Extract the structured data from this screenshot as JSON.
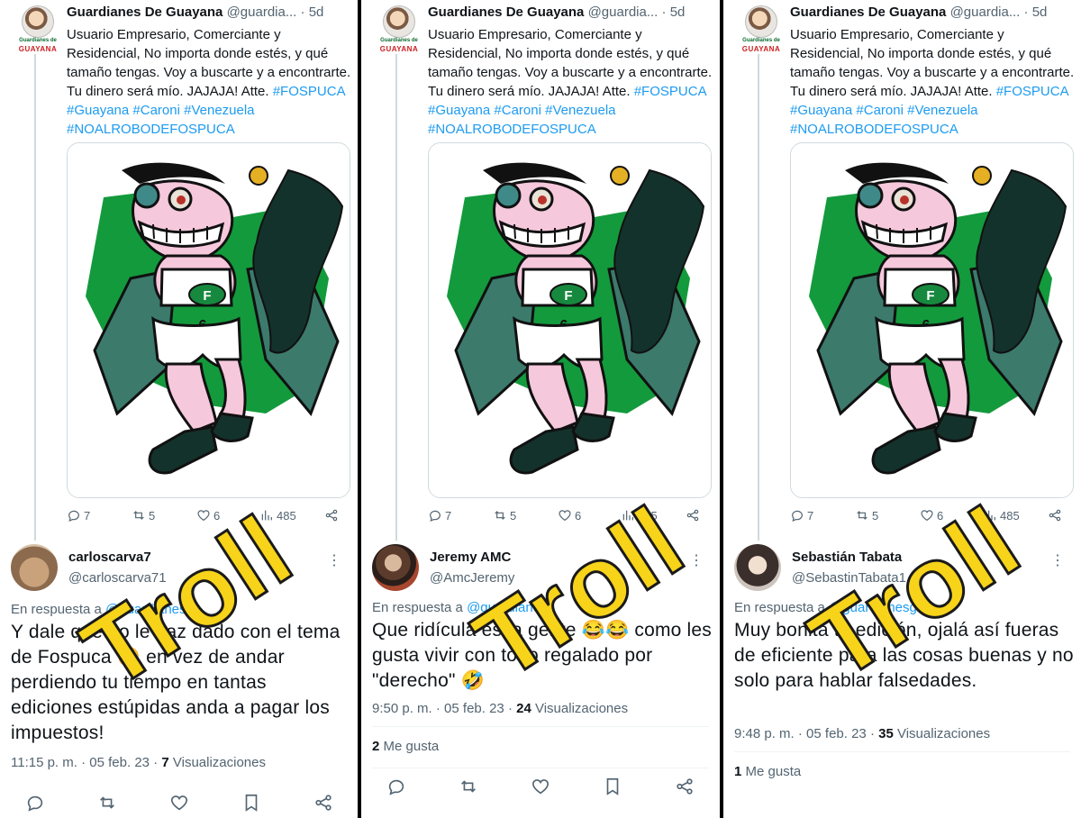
{
  "tweet": {
    "author_name": "Guardianes De Guayana",
    "author_handle": "@guardia...",
    "separator": "·",
    "time": "5d",
    "avatar_brand_top": "Guardianes de",
    "avatar_brand_bottom": "GUAYANA",
    "text_before": "Usuario Empresario, Comerciante y Residencial, No importa donde estés, y qué tamaño tengas. Voy a buscarte y a encontrarte. Tu dinero será mío. JAJAJA! Atte. ",
    "hashtags": [
      "#FOSPUCA",
      "#Guayana",
      "#Caroni",
      "#Venezuela",
      "#NOALROBODEFOSPUCA"
    ],
    "media_badge": "F",
    "media_number": "6",
    "stats": {
      "replies": "7",
      "retweets": "5",
      "likes": "6",
      "views": "485"
    }
  },
  "replies": [
    {
      "name": "carloscarva7",
      "handle": "@carloscarva71",
      "reply_to_prefix": "En respuesta a",
      "reply_to_handle": "@guardianesg",
      "text": "Y dale que no le haz dado con el tema de Fospuca 🙄 en vez de andar perdiendo tu tiempo en tantas ediciones estúpidas anda a pagar los impuestos!",
      "time": "11:15 p. m.",
      "date": "05 feb. 23",
      "views": "7",
      "views_label": "Visualizaciones",
      "likes": "",
      "likes_label": "",
      "stamp": "Troll"
    },
    {
      "name": "Jeremy AMC",
      "handle": "@AmcJeremy",
      "reply_to_prefix": "En respuesta a",
      "reply_to_handle": "@guardianesg",
      "text": "Que ridícula es la gente 😂😂 como les gusta vivir con todo regalado por \"derecho\" 🤣",
      "time": "9:50 p. m.",
      "date": "05 feb. 23",
      "views": "24",
      "views_label": "Visualizaciones",
      "likes": "2",
      "likes_label": "Me gusta",
      "stamp": "Troll"
    },
    {
      "name": "Sebastián Tabata",
      "handle": "@SebastinTabata1",
      "reply_to_prefix": "En respuesta a",
      "reply_to_handle": "@guardianesg",
      "text": "Muy bonita tu edición, ojalá así fueras de eficiente para las cosas buenas y no solo para hablar falsedades.",
      "time": "9:48 p. m.",
      "date": "05 feb. 23",
      "views": "35",
      "views_label": "Visualizaciones",
      "likes": "1",
      "likes_label": "Me gusta",
      "stamp": "Troll"
    }
  ],
  "colors": {
    "link": "#1d9bf0",
    "muted": "#536471",
    "troll_yellow": "#f7d31a",
    "media_green": "#139a3c"
  }
}
